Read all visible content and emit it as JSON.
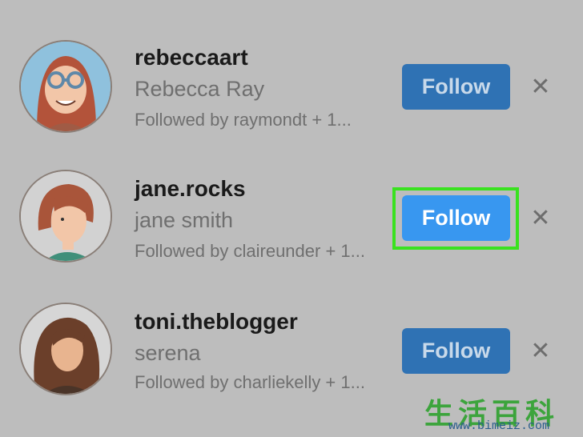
{
  "suggestions": [
    {
      "username": "rebeccaart",
      "full_name": "Rebecca Ray",
      "mutual": "Followed by raymondt + 1...",
      "follow_label": "Follow",
      "dismiss_icon": "✕",
      "avatar": "avatar-rebecca"
    },
    {
      "username": "jane.rocks",
      "full_name": "jane smith",
      "mutual": "Followed by claireunder + 1...",
      "follow_label": "Follow",
      "dismiss_icon": "✕",
      "avatar": "avatar-jane",
      "highlighted": true
    },
    {
      "username": "toni.theblogger",
      "full_name": "serena",
      "mutual": "Followed by charliekelly + 1...",
      "follow_label": "Follow",
      "dismiss_icon": "✕",
      "avatar": "avatar-toni"
    }
  ],
  "watermark": {
    "characters": "生活百科",
    "url": "www.bimeiz.com"
  },
  "colors": {
    "background": "#bdbdbd",
    "follow_dim": "#2f72b4",
    "follow_active": "#3897f0",
    "highlight": "#39e21f"
  }
}
